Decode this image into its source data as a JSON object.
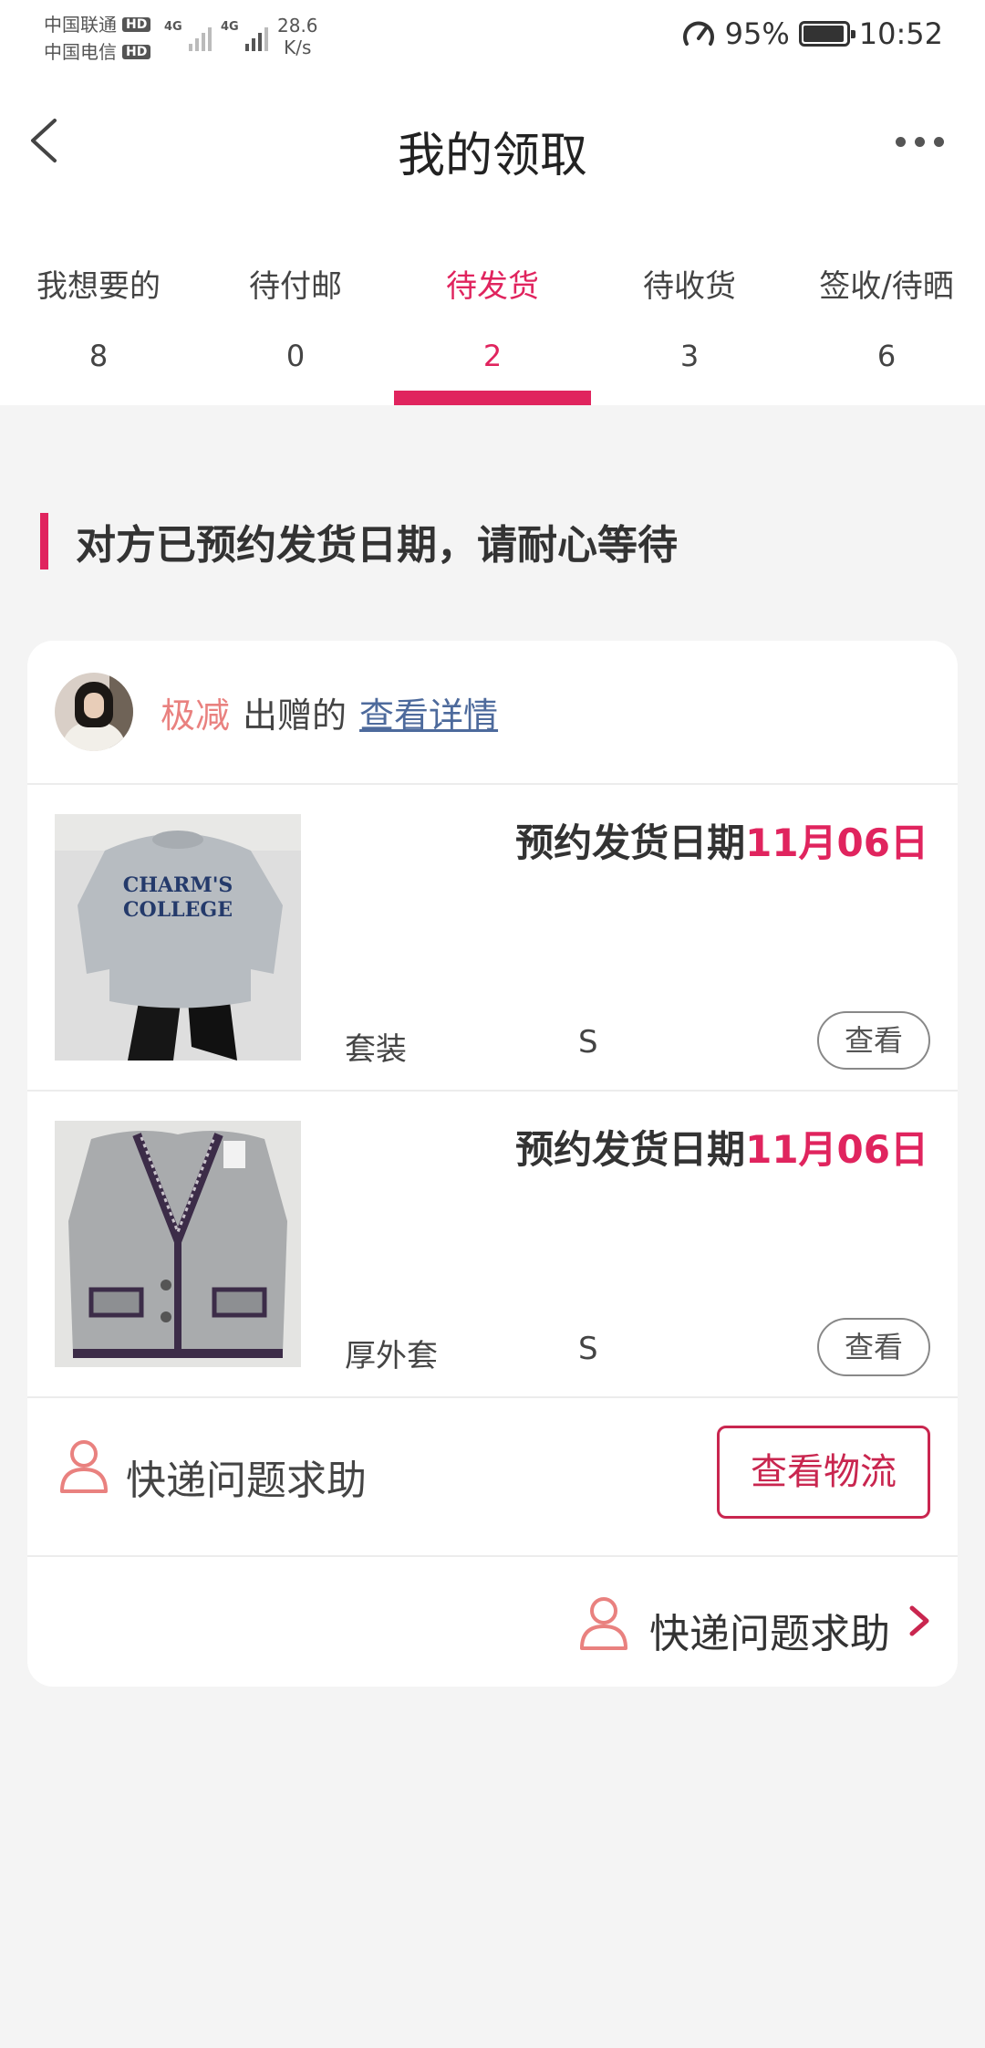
{
  "status_bar": {
    "carrier_1": "中国联通",
    "carrier_2": "中国电信",
    "hd": "HD",
    "network_1": "4G",
    "network_2": "4G",
    "speed_value": "28.6",
    "speed_unit": "K/s",
    "battery_percent": "95%",
    "battery_level": 0.95,
    "time": "10:52"
  },
  "nav": {
    "title": "我的领取"
  },
  "tabs": [
    {
      "label": "我想要的",
      "count": "8",
      "active": false
    },
    {
      "label": "待付邮",
      "count": "0",
      "active": false
    },
    {
      "label": "待发货",
      "count": "2",
      "active": true
    },
    {
      "label": "待收货",
      "count": "3",
      "active": false
    },
    {
      "label": "签收/待晒",
      "count": "6",
      "active": false
    }
  ],
  "section": {
    "title": "对方已预约发货日期，请耐心等待"
  },
  "card": {
    "giver_name": "极减",
    "giver_verb": "出赠的",
    "detail_link": "查看详情",
    "items": [
      {
        "date_label": "预约发货日期",
        "date_value": "11月06日",
        "category": "套装",
        "size": "S",
        "view_label": "查看",
        "image": "grey-sweatshirt-photo"
      },
      {
        "date_label": "预约发货日期",
        "date_value": "11月06日",
        "category": "厚外套",
        "size": "S",
        "view_label": "查看",
        "image": "tweed-jacket-photo"
      }
    ],
    "help_label": "快递问题求助",
    "logistics_button": "查看物流",
    "bottom_help_label": "快递问题求助"
  },
  "colors": {
    "accent": "#e0245e",
    "giver_name": "#e9817f",
    "link": "#4d6a9c",
    "logistics_border": "#c9264f"
  }
}
